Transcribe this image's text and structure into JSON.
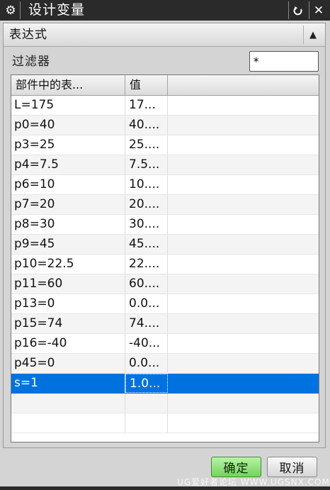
{
  "window": {
    "title": "设计变量",
    "icon": "gear-icon",
    "reset_icon": "reset-icon",
    "close_icon": "close-icon"
  },
  "group": {
    "title": "表达式",
    "collapse_icon": "chevron-up-icon"
  },
  "filter": {
    "label": "过滤器",
    "value": "*"
  },
  "table": {
    "columns": [
      "部件中的表...",
      "值"
    ],
    "rows": [
      {
        "expr": "L=175",
        "value": "17..."
      },
      {
        "expr": "p0=40",
        "value": "40...."
      },
      {
        "expr": "p3=25",
        "value": "25...."
      },
      {
        "expr": "p4=7.5",
        "value": "7.5..."
      },
      {
        "expr": "p6=10",
        "value": "10...."
      },
      {
        "expr": "p7=20",
        "value": "20...."
      },
      {
        "expr": "p8=30",
        "value": "30...."
      },
      {
        "expr": "p9=45",
        "value": "45...."
      },
      {
        "expr": "p10=22.5",
        "value": "22...."
      },
      {
        "expr": "p11=60",
        "value": "60...."
      },
      {
        "expr": "p13=0",
        "value": "0.0..."
      },
      {
        "expr": "p15=74",
        "value": "74...."
      },
      {
        "expr": "p16=-40",
        "value": "-40..."
      },
      {
        "expr": "p45=0",
        "value": "0.0..."
      },
      {
        "expr": "s=1",
        "value": "1.0..."
      }
    ],
    "selected_index": 14,
    "selection_color": "#0072e0"
  },
  "footer": {
    "ok_label": "确定",
    "cancel_label": "取消",
    "watermark": "UG爱好者论坛 WWW.UGSNX.COM"
  }
}
